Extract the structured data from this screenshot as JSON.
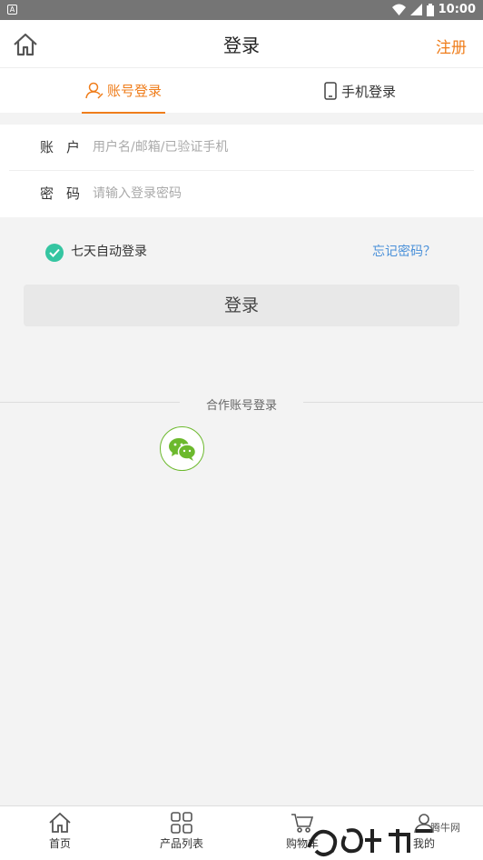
{
  "statusbar": {
    "time": "10:00"
  },
  "header": {
    "title": "登录",
    "register_label": "注册"
  },
  "tabs": [
    {
      "label": "账号登录",
      "active": true
    },
    {
      "label": "手机登录",
      "active": false
    }
  ],
  "form": {
    "account_label": "账户",
    "account_placeholder": "用户名/邮箱/已验证手机",
    "password_label": "密码",
    "password_placeholder": "请输入登录密码"
  },
  "options": {
    "auto_login_label": "七天自动登录",
    "auto_login_checked": true,
    "forgot_label": "忘记密码？"
  },
  "login_button": "登录",
  "partner": {
    "title": "合作账号登录"
  },
  "bottom_nav": [
    {
      "label": "首页",
      "icon": "home-icon"
    },
    {
      "label": "产品列表",
      "icon": "grid-icon"
    },
    {
      "label": "购物车",
      "icon": "cart-icon"
    },
    {
      "label": "我的",
      "icon": "user-icon"
    }
  ],
  "watermark": {
    "text": "腾牛网"
  },
  "colors": {
    "accent": "#ef7d1b",
    "link": "#4a90d9",
    "check": "#35c5a1",
    "wechat": "#6cb92d"
  }
}
